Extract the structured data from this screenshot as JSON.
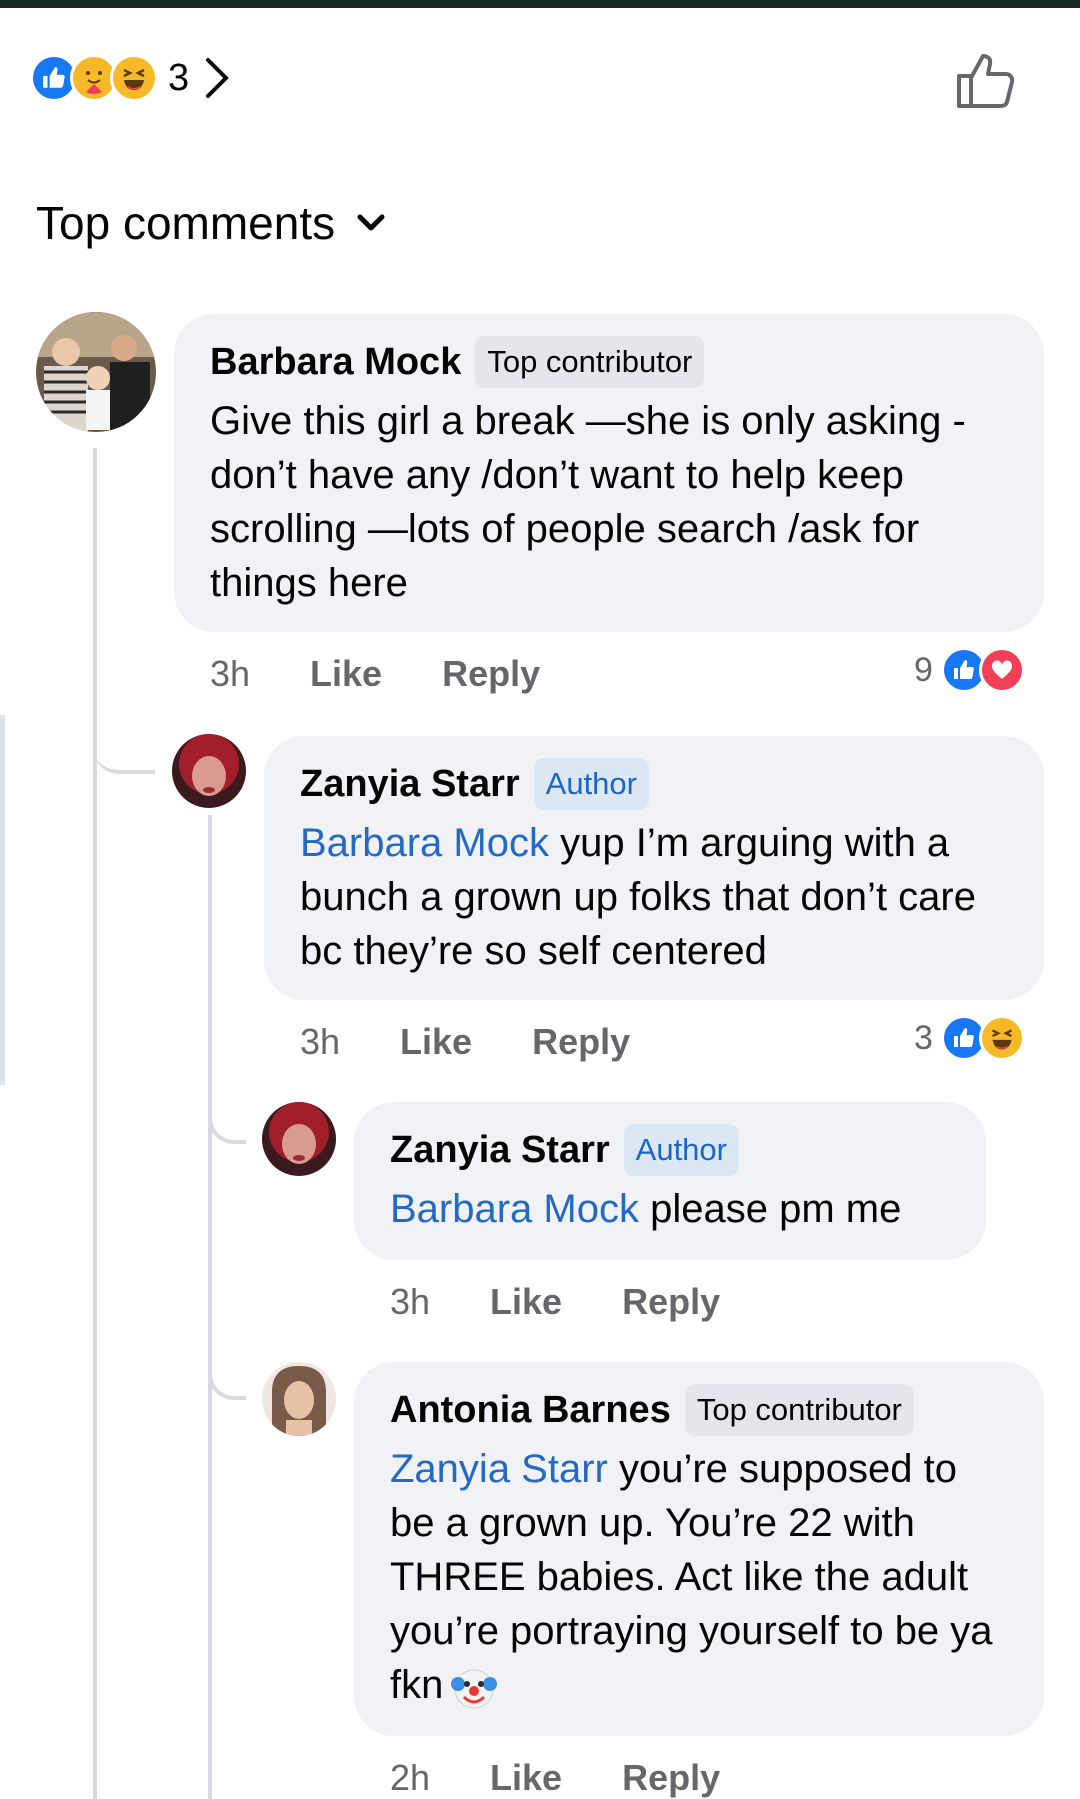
{
  "post": {
    "reaction_count": "3",
    "reactions": [
      "like-icon",
      "care-icon",
      "haha-icon"
    ]
  },
  "comments_header": {
    "sort_label": "Top comments"
  },
  "comments": [
    {
      "author": "Barbara Mock",
      "badge": "Top contributor",
      "text": "Give this girl a break —she is only asking -don’t have any /don’t want to help keep scrolling —lots of people search /ask for things here",
      "time": "3h",
      "like_label": "Like",
      "reply_label": "Reply",
      "reaction_count": "9",
      "reactions": [
        "like-icon",
        "love-icon"
      ]
    },
    {
      "author": "Zanyia Starr",
      "badge": "Author",
      "mention": "Barbara Mock",
      "text": " yup I’m arguing with a bunch a grown up folks that don’t care bc they’re so  self centered",
      "time": "3h",
      "like_label": "Like",
      "reply_label": "Reply",
      "reaction_count": "3",
      "reactions": [
        "like-icon",
        "haha-icon"
      ]
    },
    {
      "author": "Zanyia Starr",
      "badge": "Author",
      "mention": "Barbara Mock",
      "text": " please pm me",
      "time": "3h",
      "like_label": "Like",
      "reply_label": "Reply"
    },
    {
      "author": "Antonia Barnes",
      "badge": "Top contributor",
      "mention": "Zanyia Starr",
      "text": " you’re supposed to be a grown up. You’re 22 with THREE babies. Act like the adult you’re portraying yourself to be ya fkn",
      "emoji": "clown-face-icon",
      "time": "2h",
      "like_label": "Like",
      "reply_label": "Reply"
    }
  ],
  "colors": {
    "like_blue": "#1877f2",
    "love_red": "#f33e58",
    "mention_blue": "#2469c4",
    "author_badge_bg": "#dbe7f2",
    "bubble_bg": "#f0f2f5",
    "secondary_text": "#65676b"
  }
}
